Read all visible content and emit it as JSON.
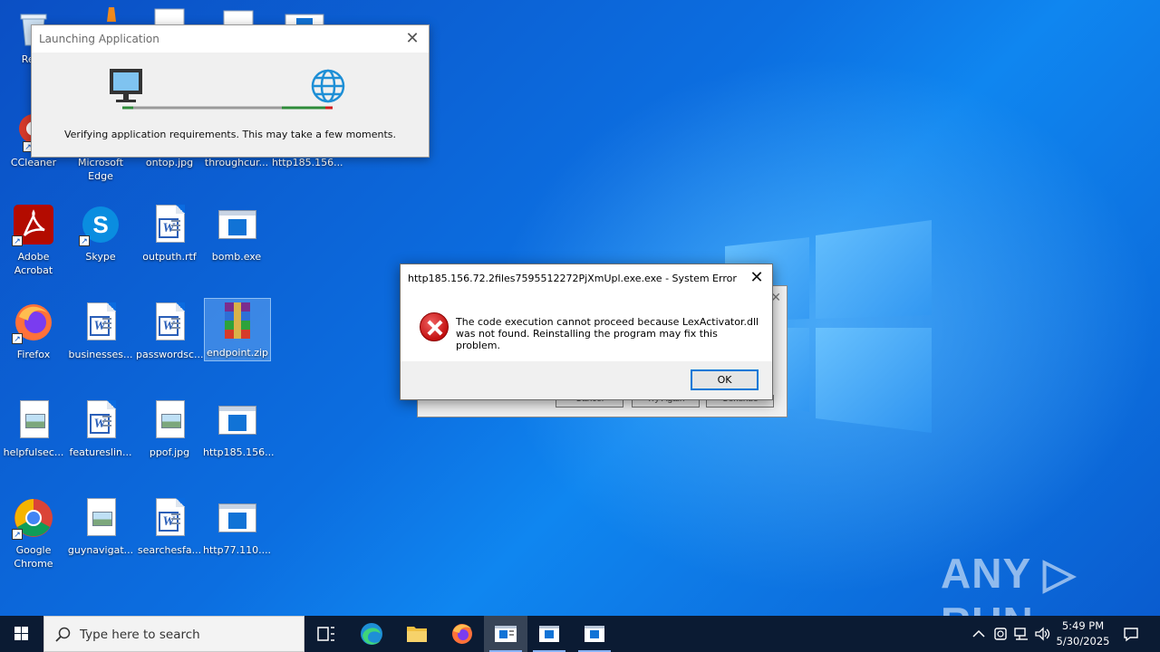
{
  "desktop": {
    "icons": [
      {
        "label": "Recy"
      },
      {
        "label": "CCleaner"
      },
      {
        "label": "Microsoft Edge"
      },
      {
        "label": "ontop.jpg"
      },
      {
        "label": "throughcur..."
      },
      {
        "label": "http185.156..."
      },
      {
        "label": "Adobe Acrobat"
      },
      {
        "label": "Skype"
      },
      {
        "label": "outputh.rtf"
      },
      {
        "label": "bomb.exe"
      },
      {
        "label": "Firefox"
      },
      {
        "label": "businesses..."
      },
      {
        "label": "passwordsc..."
      },
      {
        "label": "endpoint.zip"
      },
      {
        "label": "helpfulsec..."
      },
      {
        "label": "featureslin..."
      },
      {
        "label": "ppof.jpg"
      },
      {
        "label": "http185.156..."
      },
      {
        "label": "Google Chrome"
      },
      {
        "label": "guynavigat..."
      },
      {
        "label": "searchesfa..."
      },
      {
        "label": "http77.110...."
      }
    ]
  },
  "launch_dialog": {
    "title": "Launching Application",
    "message": "Verifying application requirements. This may take a few moments."
  },
  "back_dialog": {
    "buttons": [
      "Cancel",
      "Try Again",
      "Continue"
    ]
  },
  "error_dialog": {
    "title": "http185.156.72.2files7595512272PjXmUpl.exe.exe - System Error",
    "message_line1": "The code execution cannot proceed because LexActivator.dll",
    "message_line2": "was not found. Reinstalling the program may fix this problem.",
    "ok_label": "OK"
  },
  "watermark": "ANY ▷ RUN",
  "taskbar": {
    "search_placeholder": "Type here to search",
    "time": "5:49 PM",
    "date": "5/30/2025"
  }
}
